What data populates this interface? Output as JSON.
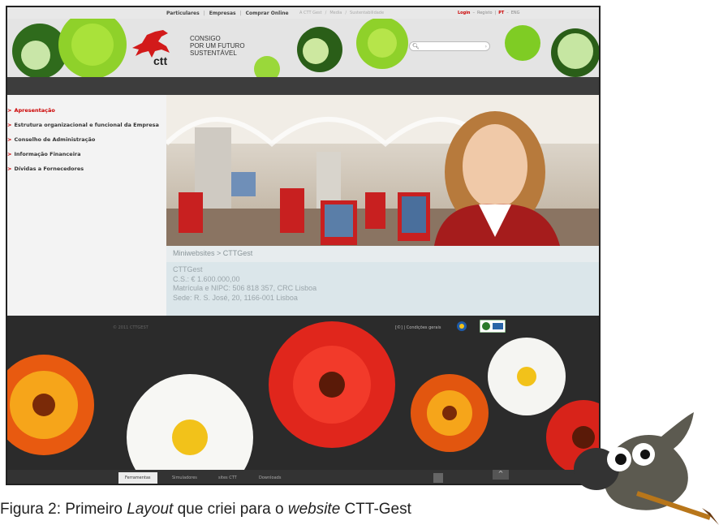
{
  "topbar": {
    "nav": [
      "Particulares",
      "Empresas",
      "Comprar Online"
    ],
    "sub": [
      "A CTT Gest",
      "Media",
      "Sustentabilidade"
    ],
    "lang": {
      "login": "Login",
      "register": "Registo",
      "pt": "PT",
      "eng": "ENG"
    }
  },
  "banner": {
    "logo_text": "ctt",
    "slogan": [
      "CONSIGO",
      "POR UM FUTURO",
      "SUSTENTÁVEL"
    ]
  },
  "nav": [
    {
      "label": "Apresentação"
    },
    {
      "label": "Estrutura organizacional e funcional da Empresa"
    },
    {
      "label": "Conselho de Administração"
    },
    {
      "label": "Informação Financeira"
    },
    {
      "label": "Dívidas a Fornecedores"
    }
  ],
  "breadcrumb": "Miniwebsites > CTTGest",
  "info": [
    "CTTGest",
    "C.S.: € 1.600.000,00",
    "Matrícula e NIPC: 506 818 357, CRC Lisboa",
    "Sede: R. S. José, 20, 1166-001 Lisboa"
  ],
  "footer": {
    "copyright": "© 2011 CTTGEST",
    "links": "[©] | Condições gerais"
  },
  "bottom_tabs": [
    "Ferramentas",
    "Simuladores",
    "sites CTT",
    "Downloads"
  ],
  "caption": {
    "p1": "Figura 2: Primeiro ",
    "p2": "Layout",
    "p3": " que criei para o ",
    "p4": "website",
    "p5": " CTT-Gest"
  },
  "colors": {
    "accent": "#cc0000",
    "dark": "#3d3d3d"
  }
}
